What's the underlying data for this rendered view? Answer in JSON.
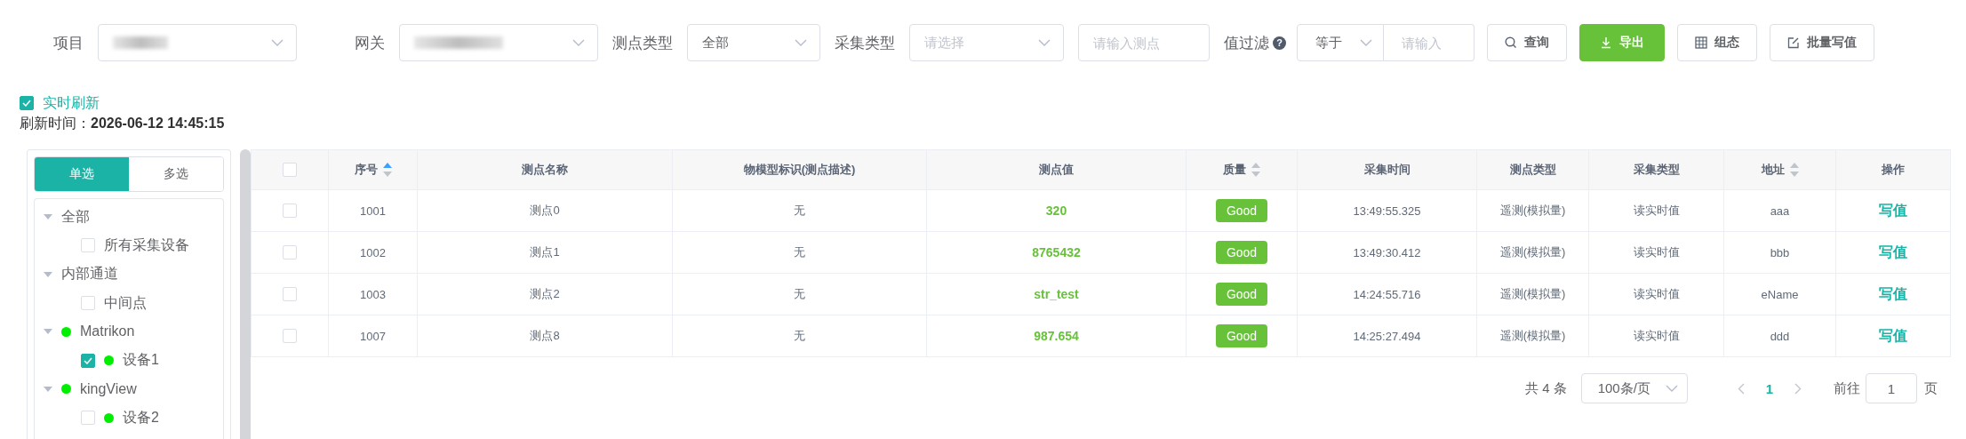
{
  "filters": {
    "project": {
      "label": "项目"
    },
    "gateway": {
      "label": "网关"
    },
    "point_type": {
      "label": "测点类型",
      "value": "全部"
    },
    "collect_type": {
      "label": "采集类型",
      "placeholder": "请选择"
    },
    "point_name": {
      "placeholder": "请输入测点"
    },
    "value_filter": {
      "label": "值过滤",
      "help": "?",
      "operator": "等于",
      "placeholder": "请输入"
    }
  },
  "buttons": [
    {
      "label": "查询",
      "kind": "search",
      "primary": false
    },
    {
      "label": "导出",
      "kind": "export",
      "primary": true
    },
    {
      "label": "组态",
      "kind": "config",
      "primary": false
    },
    {
      "label": "批量写值",
      "kind": "edit",
      "primary": false
    }
  ],
  "realtime": {
    "label": "实时刷新",
    "checked": true
  },
  "refresh_time": {
    "label": "刷新时间：",
    "value": "2026-06-12 14:45:15"
  },
  "sidebar": {
    "modes": [
      {
        "label": "单选",
        "selected": true
      },
      {
        "label": "多选",
        "selected": false
      }
    ],
    "tree": [
      {
        "label": "全部",
        "expanded": true,
        "children": [
          {
            "label": "所有采集设备",
            "checked": false
          }
        ]
      },
      {
        "label": "内部通道",
        "expanded": true,
        "children": [
          {
            "label": "中间点",
            "checked": false
          }
        ]
      },
      {
        "label": "Matrikon",
        "expanded": true,
        "online": true,
        "children": [
          {
            "label": "设备1",
            "checked": true,
            "online": true
          }
        ]
      },
      {
        "label": "kingView",
        "expanded": true,
        "online": true,
        "children": [
          {
            "label": "设备2",
            "checked": false,
            "online": true
          }
        ]
      }
    ]
  },
  "table": {
    "all_checked": false,
    "columns": [
      {
        "label": "序号",
        "sortable": true,
        "sorted_asc": true
      },
      {
        "label": "测点名称",
        "sortable": false
      },
      {
        "label": "物模型标识(测点描述)",
        "sortable": false
      },
      {
        "label": "测点值",
        "sortable": false
      },
      {
        "label": "质量",
        "sortable": true,
        "sorted_asc": false
      },
      {
        "label": "采集时间",
        "sortable": false
      },
      {
        "label": "测点类型",
        "sortable": false
      },
      {
        "label": "采集类型",
        "sortable": false
      },
      {
        "label": "地址",
        "sortable": true,
        "sorted_asc": false
      },
      {
        "label": "操作",
        "sortable": false
      }
    ],
    "rows": [
      {
        "checked": false,
        "id": "1001",
        "name": "测点0",
        "model": "无",
        "value": "320",
        "quality": "Good",
        "time": "13:49:55.325",
        "point_type": "遥测(模拟量)",
        "collect_type": "读实时值",
        "address": "aaa",
        "action": "写值"
      },
      {
        "checked": false,
        "id": "1002",
        "name": "测点1",
        "model": "无",
        "value": "8765432",
        "quality": "Good",
        "time": "13:49:30.412",
        "point_type": "遥测(模拟量)",
        "collect_type": "读实时值",
        "address": "bbb",
        "action": "写值"
      },
      {
        "checked": false,
        "id": "1003",
        "name": "测点2",
        "model": "无",
        "value": "str_test",
        "quality": "Good",
        "time": "14:24:55.716",
        "point_type": "遥测(模拟量)",
        "collect_type": "读实时值",
        "address": "eName",
        "action": "写值"
      },
      {
        "checked": false,
        "id": "1007",
        "name": "测点8",
        "model": "无",
        "value": "987.654",
        "quality": "Good",
        "time": "14:25:27.494",
        "point_type": "遥测(模拟量)",
        "collect_type": "读实时值",
        "address": "ddd",
        "action": "写值"
      }
    ]
  },
  "pagination": {
    "total": "共 4 条",
    "page_size": "100条/页",
    "pages": [
      {
        "label": "1",
        "selected": true
      }
    ],
    "goto_label": "前往",
    "goto_value": "1",
    "goto_suffix": "页"
  }
}
